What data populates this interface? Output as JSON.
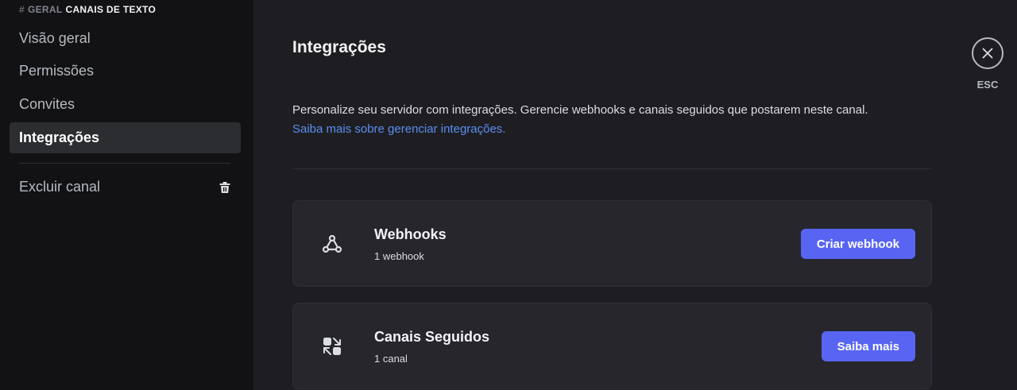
{
  "sidebar": {
    "header": {
      "hash": "#",
      "channel": "GERAL",
      "section": "CANAIS DE TEXTO"
    },
    "items": [
      {
        "label": "Visão geral"
      },
      {
        "label": "Permissões"
      },
      {
        "label": "Convites"
      },
      {
        "label": "Integrações",
        "active": true
      }
    ],
    "delete_label": "Excluir canal",
    "delete_icon": "trash-icon"
  },
  "main": {
    "title": "Integrações",
    "description": "Personalize seu servidor com integrações. Gerencie webhooks e canais seguidos que postarem neste canal.",
    "link": "Saiba mais sobre gerenciar integrações.",
    "cards": [
      {
        "icon": "webhook-icon",
        "title": "Webhooks",
        "subtitle": "1 webhook",
        "button": "Criar webhook"
      },
      {
        "icon": "followed-channels-icon",
        "title": "Canais Seguidos",
        "subtitle": "1 canal",
        "button": "Saiba mais"
      }
    ]
  },
  "close": {
    "icon": "close-icon",
    "label": "ESC"
  },
  "colors": {
    "accent": "#5865f2",
    "link": "#5b8ef0"
  }
}
